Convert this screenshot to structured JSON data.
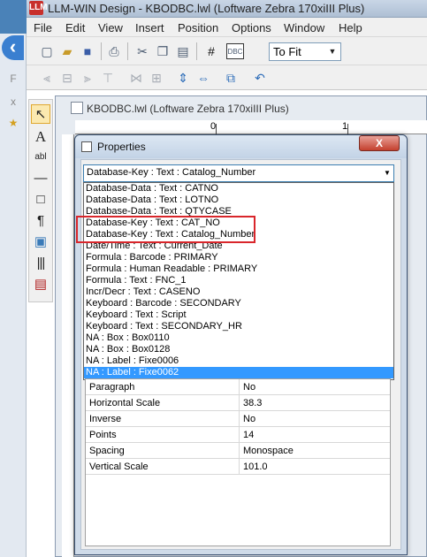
{
  "window": {
    "title": "LLM-WIN Design - KBODBC.lwl (Loftware Zebra 170xiIII Plus)",
    "icon": "app-logo-icon"
  },
  "menubar": [
    {
      "label": "File"
    },
    {
      "label": "Edit"
    },
    {
      "label": "View"
    },
    {
      "label": "Insert"
    },
    {
      "label": "Position"
    },
    {
      "label": "Options"
    },
    {
      "label": "Window"
    },
    {
      "label": "Help"
    }
  ],
  "toolbar": {
    "zoom_value": "To Fit",
    "row1_icons": [
      "new-icon",
      "open-icon",
      "save-icon",
      "print-icon",
      "cut-icon",
      "copy-icon",
      "paste-icon",
      "grid-icon",
      "odbc-icon"
    ],
    "row2_icons": [
      "align-left-icon",
      "align-center-icon",
      "align-right-icon",
      "distribute-h-icon",
      "distribute-v-icon",
      "center-v-icon",
      "center-h-icon",
      "front-icon",
      "undo-icon"
    ]
  },
  "palette": {
    "tools": [
      "select-icon",
      "text-icon",
      "field-icon",
      "line-icon",
      "box-icon",
      "paragraph-icon",
      "image-icon",
      "barcode-icon",
      "rfid-icon"
    ],
    "text_glyph": "A",
    "field_glyph": "abl",
    "paragraph_glyph": "¶"
  },
  "document": {
    "title": "KBODBC.lwl (Loftware Zebra 170xiIII Plus)",
    "ruler_labels": [
      "0",
      "1"
    ]
  },
  "dialog": {
    "title": "Properties",
    "close_label": "X",
    "selected_field": "Database-Key : Text : Catalog_Number",
    "options": [
      {
        "label": "Database-Data : Text : CATNO",
        "selected": false
      },
      {
        "label": "Database-Data : Text : LOTNO",
        "selected": false
      },
      {
        "label": "Database-Data : Text : QTYCASE",
        "selected": false
      },
      {
        "label": "Database-Key : Text : CAT_NO",
        "selected": false
      },
      {
        "label": "Database-Key : Text : Catalog_Number",
        "selected": false
      },
      {
        "label": "Date/Time : Text : Current_Date",
        "selected": false
      },
      {
        "label": "Formula : Barcode : PRIMARY",
        "selected": false
      },
      {
        "label": "Formula : Human Readable : PRIMARY",
        "selected": false
      },
      {
        "label": "Formula : Text : FNC_1",
        "selected": false
      },
      {
        "label": "Incr/Decr : Text : CASENO",
        "selected": false
      },
      {
        "label": "Keyboard : Barcode : SECONDARY",
        "selected": false
      },
      {
        "label": "Keyboard : Text : Script",
        "selected": false
      },
      {
        "label": "Keyboard : Text : SECONDARY_HR",
        "selected": false
      },
      {
        "label": "NA : Box : Box0110",
        "selected": false
      },
      {
        "label": "NA : Box : Box0128",
        "selected": false
      },
      {
        "label": "NA : Label : Fixe0006",
        "selected": false
      },
      {
        "label": "NA : Label : Fixe0062",
        "selected": true
      }
    ],
    "properties": [
      {
        "name": "Paragraph",
        "value": "No"
      },
      {
        "name": "Horizontal Scale",
        "value": "38.3"
      },
      {
        "name": "Inverse",
        "value": "No"
      },
      {
        "name": "Points",
        "value": "14"
      },
      {
        "name": "Spacing",
        "value": "Monospace"
      },
      {
        "name": "Vertical Scale",
        "value": "101.0"
      }
    ]
  },
  "colors": {
    "selection": "#3399ff",
    "highlight_box": "#d9262b",
    "close_button": "#c4402e"
  }
}
